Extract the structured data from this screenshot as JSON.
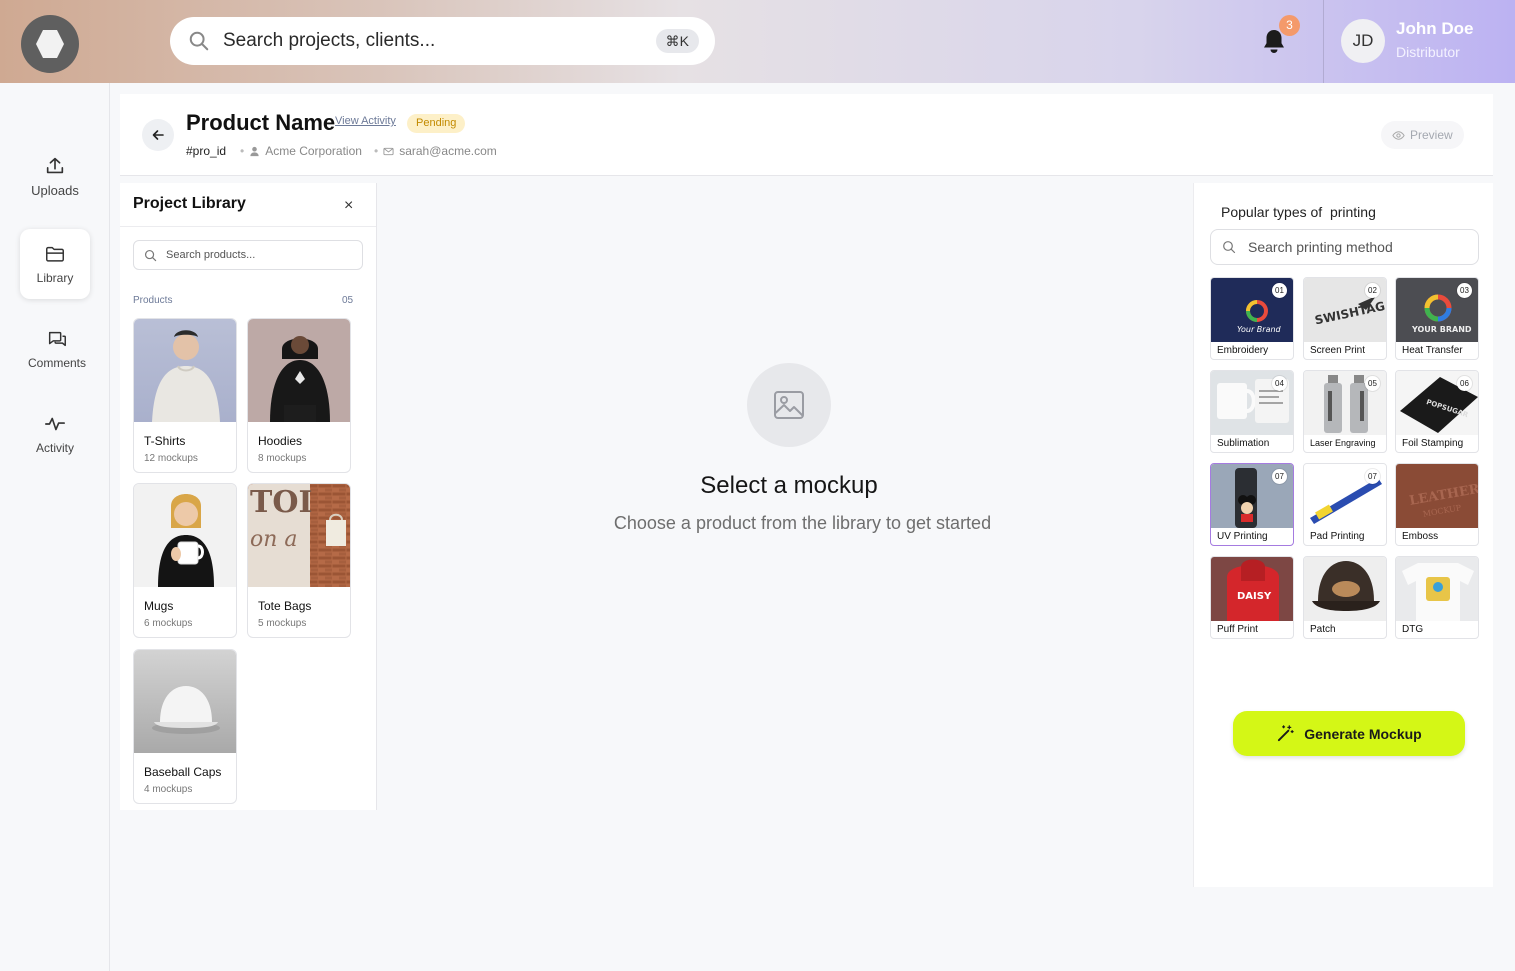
{
  "topbar": {
    "search_placeholder": "Search projects, clients...",
    "shortcut": "⌘K",
    "notification_count": "3",
    "user": {
      "initials": "JD",
      "name": "John Doe",
      "role": "Distributor"
    }
  },
  "nav": [
    {
      "label": "Uploads",
      "icon": "upload-icon"
    },
    {
      "label": "Library",
      "icon": "folder-icon",
      "active": true
    },
    {
      "label": "Comments",
      "icon": "chat-icon"
    },
    {
      "label": "Activity",
      "icon": "activity-icon"
    }
  ],
  "header": {
    "title": "Product Name",
    "view_activity": "View Activity",
    "status": "Pending",
    "project_id": "#pro_id",
    "client": "Acme Corporation",
    "email": "sarah@acme.com",
    "preview_label": "Preview"
  },
  "library": {
    "title": "Project Library",
    "close": "×",
    "search_placeholder": "Search products...",
    "products_label": "Products",
    "products_count": "05",
    "products": [
      {
        "name": "T-Shirts",
        "count": "12 mockups"
      },
      {
        "name": "Hoodies",
        "count": "8 mockups"
      },
      {
        "name": "Mugs",
        "count": "6 mockups"
      },
      {
        "name": "Tote Bags",
        "count": "5 mockups"
      },
      {
        "name": "Baseball Caps",
        "count": "4 mockups"
      }
    ]
  },
  "center": {
    "title": "Select a mockup",
    "subtitle": "Choose a product from the library to get started"
  },
  "printing": {
    "title": "Popular types of  printing",
    "search_placeholder": "Search printing method",
    "methods": [
      {
        "label": "Embroidery",
        "num": "01"
      },
      {
        "label": "Screen Print",
        "num": "02"
      },
      {
        "label": "Heat Transfer",
        "num": "03"
      },
      {
        "label": "Sublimation",
        "num": "04"
      },
      {
        "label": "Laser Engraving",
        "num": "05"
      },
      {
        "label": "Foil Stamping",
        "num": "06"
      },
      {
        "label": "UV Printing",
        "num": "07",
        "selected": true
      },
      {
        "label": "Pad Printing",
        "num": "07"
      },
      {
        "label": "Emboss"
      },
      {
        "label": "Puff Print"
      },
      {
        "label": "Patch"
      },
      {
        "label": "DTG"
      }
    ],
    "generate_label": "Generate Mockup"
  },
  "colors": {
    "accent": "#d4f716",
    "pending_bg": "#fdf0c8",
    "pending_text": "#c28a00",
    "badge": "#f49a6b",
    "selected_border": "#a57be0"
  }
}
